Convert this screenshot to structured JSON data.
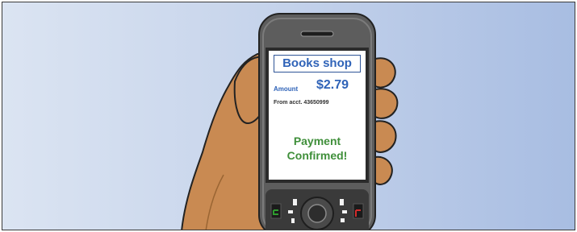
{
  "screen": {
    "shop_name": "Books shop",
    "amount_label": "Amount",
    "amount_value": "$2.79",
    "from_account": "From acct. 43650999",
    "status_line1": "Payment",
    "status_line2": "Confirmed!"
  },
  "colors": {
    "background_left": "#dbe4f2",
    "background_right": "#a8bde2",
    "phone_body": "#5d5d5d",
    "skin": "#c98a52",
    "accent_blue": "#2f63b8",
    "confirm_green": "#3f8f3a",
    "call_green": "#2e9d2e",
    "end_red": "#d22b2b"
  },
  "icons": [
    "call-icon",
    "end-call-icon",
    "navigation-pad-icon"
  ]
}
